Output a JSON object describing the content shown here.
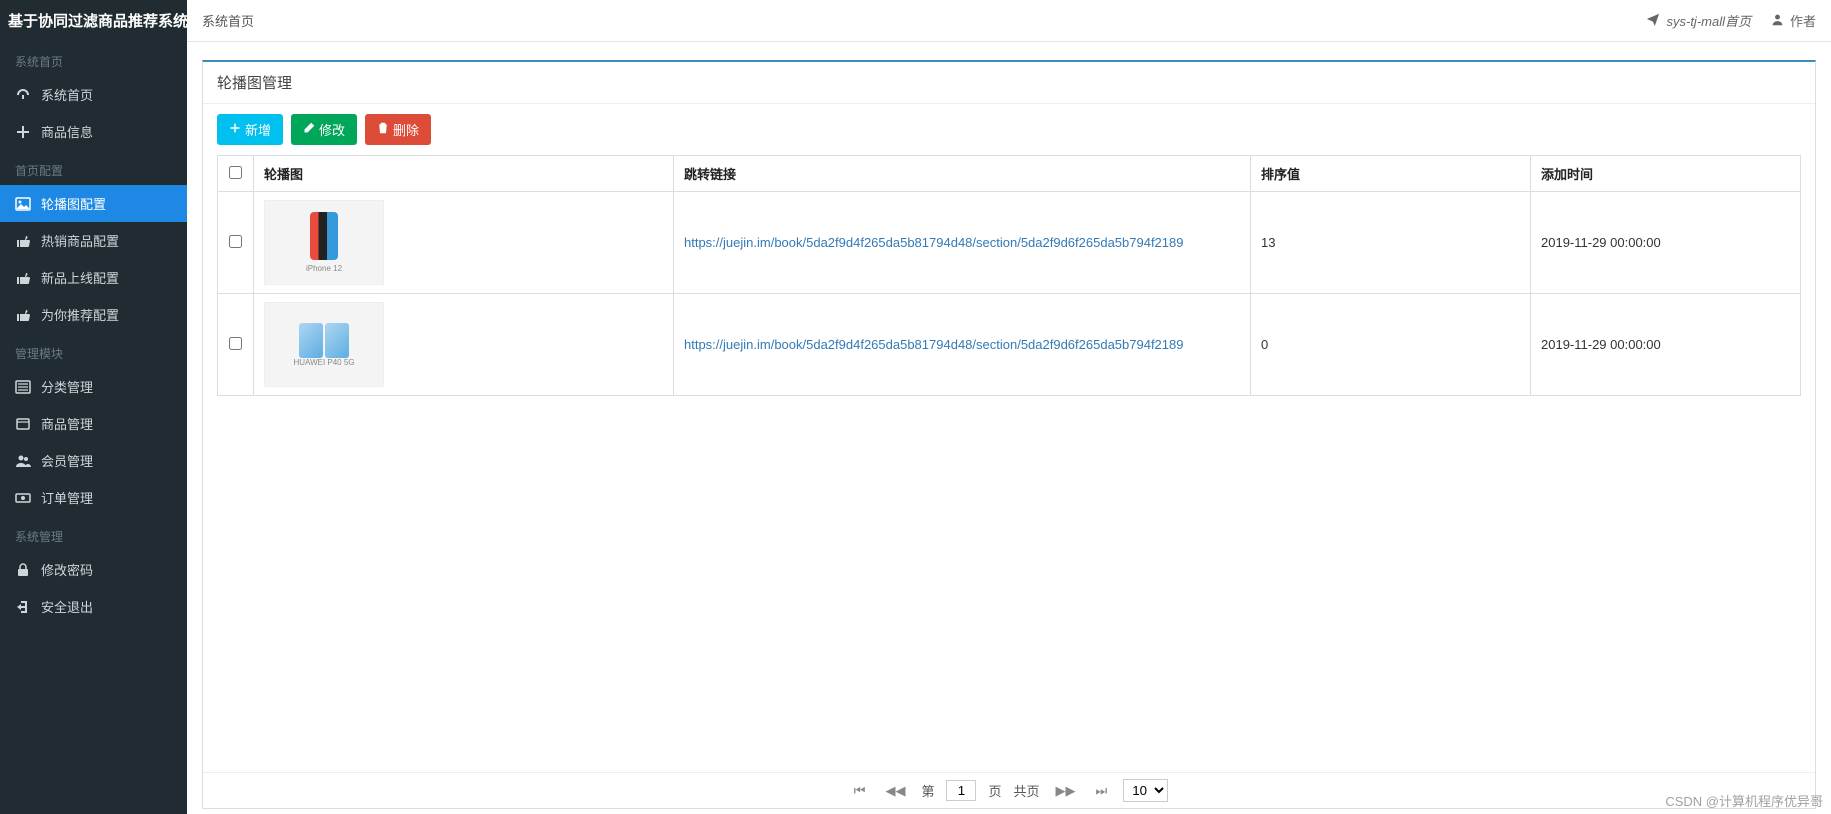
{
  "app": {
    "title": "基于协同过滤商品推荐系统"
  },
  "sidebar": {
    "sections": [
      {
        "title": "系统首页",
        "items": [
          {
            "id": "dashboard",
            "label": "系统首页",
            "icon": "dashboard-icon"
          },
          {
            "id": "product-info",
            "label": "商品信息",
            "icon": "plus-icon"
          }
        ]
      },
      {
        "title": "首页配置",
        "items": [
          {
            "id": "carousel-config",
            "label": "轮播图配置",
            "icon": "image-icon",
            "active": true
          },
          {
            "id": "hot-config",
            "label": "热销商品配置",
            "icon": "thumbs-up-icon"
          },
          {
            "id": "new-config",
            "label": "新品上线配置",
            "icon": "thumbs-up-icon"
          },
          {
            "id": "recommend-config",
            "label": "为你推荐配置",
            "icon": "thumbs-up-icon"
          }
        ]
      },
      {
        "title": "管理模块",
        "items": [
          {
            "id": "category-manage",
            "label": "分类管理",
            "icon": "list-icon"
          },
          {
            "id": "product-manage",
            "label": "商品管理",
            "icon": "box-icon"
          },
          {
            "id": "member-manage",
            "label": "会员管理",
            "icon": "users-icon"
          },
          {
            "id": "order-manage",
            "label": "订单管理",
            "icon": "money-icon"
          }
        ]
      },
      {
        "title": "系统管理",
        "items": [
          {
            "id": "change-pwd",
            "label": "修改密码",
            "icon": "lock-icon"
          },
          {
            "id": "logout",
            "label": "安全退出",
            "icon": "signout-icon"
          }
        ]
      }
    ]
  },
  "topbar": {
    "breadcrumb": "系统首页",
    "links": {
      "home": "sys-tj-mall首页",
      "author": "作者"
    }
  },
  "panel": {
    "title": "轮播图管理"
  },
  "toolbar": {
    "add_label": "新增",
    "edit_label": "修改",
    "delete_label": "删除"
  },
  "table": {
    "headers": {
      "image": "轮播图",
      "link": "跳转链接",
      "order": "排序值",
      "time": "添加时间"
    },
    "rows": [
      {
        "thumb_caption": "iPhone 12",
        "link": "https://juejin.im/book/5da2f9d4f265da5b81794d48/section/5da2f9d6f265da5b794f2189",
        "order": "13",
        "time": "2019-11-29 00:00:00"
      },
      {
        "thumb_caption": "HUAWEI P40 5G",
        "link": "https://juejin.im/book/5da2f9d4f265da5b81794d48/section/5da2f9d6f265da5b794f2189",
        "order": "0",
        "time": "2019-11-29 00:00:00"
      }
    ]
  },
  "pagination": {
    "page_label_prefix": "第",
    "page_value": "1",
    "page_label_suffix": "页",
    "total_label": "共页",
    "size_value": "10"
  },
  "watermark": "CSDN @计算机程序优异哥"
}
